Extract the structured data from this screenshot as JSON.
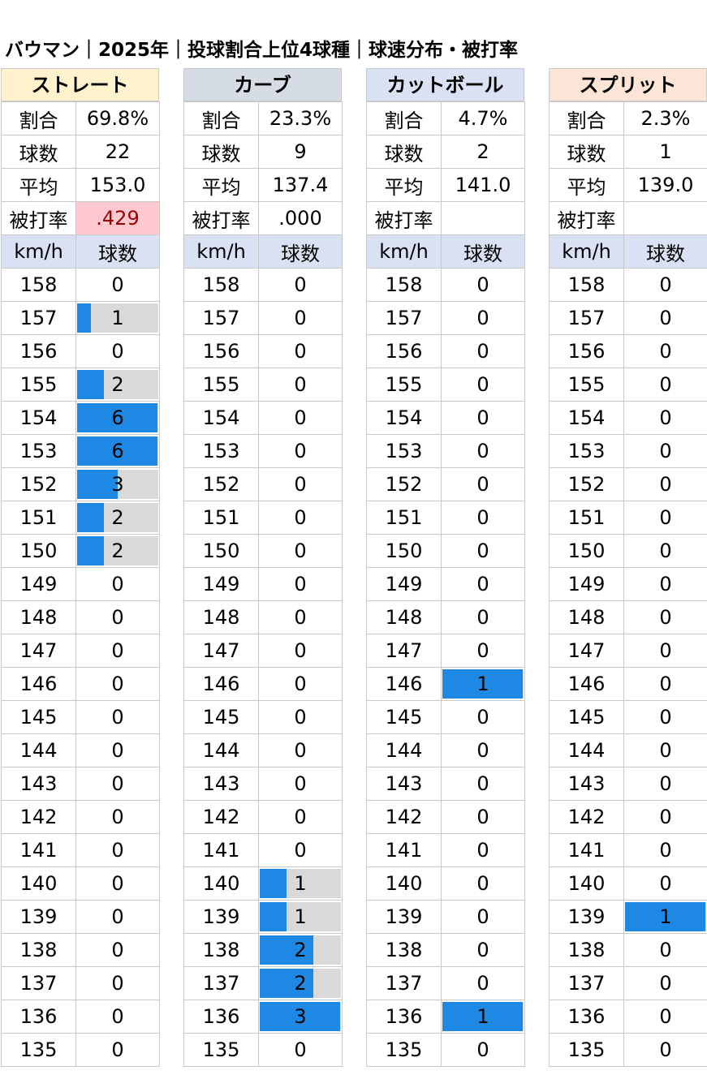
{
  "title": "バウマン｜2025年｜投球割合上位4球種｜球速分布・被打率",
  "labels": {
    "ratio": "割合",
    "count": "球数",
    "avg": "平均",
    "babip": "被打率",
    "kmh": "km/h",
    "balls": "球数"
  },
  "colors": {
    "bar": "#1e88e5",
    "bar_bg": "#d9d9d9",
    "header_blue": "#d9e1f2",
    "red_bg": "#ffc7ce",
    "red_text": "#9c0006"
  },
  "speeds": [
    "158",
    "157",
    "156",
    "155",
    "154",
    "153",
    "152",
    "151",
    "150",
    "149",
    "148",
    "147",
    "146",
    "145",
    "144",
    "143",
    "142",
    "141",
    "140",
    "139",
    "138",
    "137",
    "136",
    "135"
  ],
  "pitches": [
    {
      "name": "ストレート",
      "color": "#fff2cc",
      "ratio": "69.8%",
      "count": "22",
      "avg": "153.0",
      "babip": ".429",
      "babip_highlight": true,
      "max": 6,
      "dist": [
        0,
        1,
        0,
        2,
        6,
        6,
        3,
        2,
        2,
        0,
        0,
        0,
        0,
        0,
        0,
        0,
        0,
        0,
        0,
        0,
        0,
        0,
        0,
        0
      ]
    },
    {
      "name": "カーブ",
      "color": "#d6dce4",
      "ratio": "23.3%",
      "count": "9",
      "avg": "137.4",
      "babip": ".000",
      "babip_highlight": false,
      "max": 3,
      "dist": [
        0,
        0,
        0,
        0,
        0,
        0,
        0,
        0,
        0,
        0,
        0,
        0,
        0,
        0,
        0,
        0,
        0,
        0,
        1,
        1,
        2,
        2,
        3,
        0
      ]
    },
    {
      "name": "カットボール",
      "color": "#d9e1f2",
      "ratio": "4.7%",
      "count": "2",
      "avg": "141.0",
      "babip": "",
      "babip_highlight": false,
      "max": 1,
      "dist": [
        0,
        0,
        0,
        0,
        0,
        0,
        0,
        0,
        0,
        0,
        0,
        0,
        1,
        0,
        0,
        0,
        0,
        0,
        0,
        0,
        0,
        0,
        1,
        0
      ]
    },
    {
      "name": "スプリット",
      "color": "#fce4d6",
      "ratio": "2.3%",
      "count": "1",
      "avg": "139.0",
      "babip": "",
      "babip_highlight": false,
      "max": 1,
      "dist": [
        0,
        0,
        0,
        0,
        0,
        0,
        0,
        0,
        0,
        0,
        0,
        0,
        0,
        0,
        0,
        0,
        0,
        0,
        0,
        1,
        0,
        0,
        0,
        0
      ]
    }
  ]
}
